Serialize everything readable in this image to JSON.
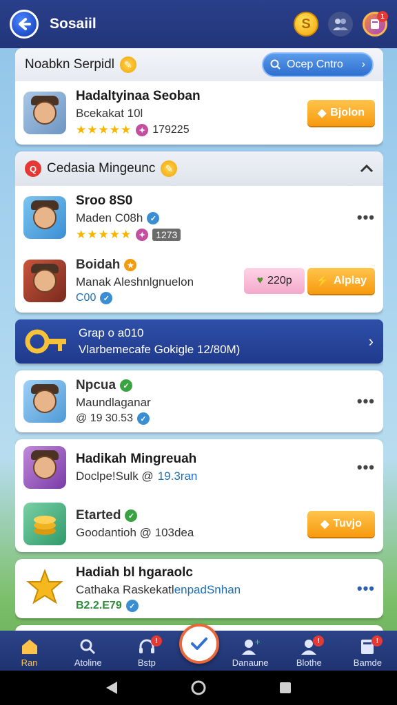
{
  "appbar": {
    "title": "Sosaiil"
  },
  "top": {
    "coin_glyph": "S",
    "avatar_badge": "1"
  },
  "section1": {
    "title": "Noabkn Serpidl",
    "search_label": "Ocep Cntro"
  },
  "featured": {
    "name": "Hadaltyinaa Seoban",
    "sub": "Bcekakat 10l",
    "stars": "★★★★★",
    "count": "179225",
    "button": "Bjolon"
  },
  "section2": {
    "title": "Cedasia Mingeunc"
  },
  "list_a": [
    {
      "name": "Sroo 8S0",
      "sub": "Maden C08h",
      "stars": "★★★★★",
      "tag": "1273"
    },
    {
      "name": "Boidah",
      "sub": "Manak Aleshnlgnuelon",
      "extra": "C00",
      "pink_button": "220p",
      "button": "Alplay"
    }
  ],
  "banner": {
    "line1": "Grap o a010",
    "line2": "Vlarbemecafe Gokigle 12/80M)"
  },
  "list_b": [
    {
      "name": "Npcua",
      "sub": "Maundlaganar",
      "meta": "@ 19 30.53"
    },
    {
      "name": "Hadikah Mingreuah",
      "sub": "Doclpe!Sulk @",
      "sub_link": "19.3ran"
    },
    {
      "name": "Etarted",
      "sub": "Goodantioh @ 103dea",
      "button": "Tuvjo"
    },
    {
      "name": "Hadiah bl hgaraolc",
      "sub": "Cathaka Raskekatl",
      "sub_link": "enpadSnhan",
      "meta": "B2.2.E79"
    }
  ],
  "bottom_nav": [
    {
      "label": "Ran",
      "icon": "home-icon"
    },
    {
      "label": "Atoline",
      "icon": "search-person-icon"
    },
    {
      "label": "Bstp",
      "icon": "headset-icon"
    },
    {
      "label": "Danaune",
      "icon": "user-plus-icon"
    },
    {
      "label": "Blothe",
      "icon": "user-icon"
    },
    {
      "label": "Bamde",
      "icon": "book-icon"
    }
  ],
  "colors": {
    "appbar": "#22357a",
    "accent_orange": "#f79a0e",
    "banner": "#1f3a8c"
  }
}
